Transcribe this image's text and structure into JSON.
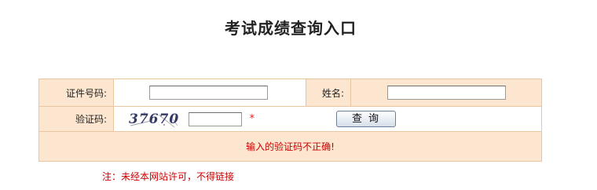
{
  "page": {
    "title": "考试成绩查询入口"
  },
  "form": {
    "id_label": "证件号码:",
    "name_label": "姓名:",
    "captcha_label": "验证码:",
    "id_value": "",
    "name_value": "",
    "captcha_image_text": "37670",
    "captcha_value": "",
    "required_mark": "*",
    "query_button": "查询",
    "error_message": "输入的验证码不正确!"
  },
  "footer": {
    "note": "注：未经本网站许可，不得链接"
  },
  "colors": {
    "label_bg": "#fde6cf",
    "border": "#e8c7a0",
    "error": "#cc0000"
  }
}
